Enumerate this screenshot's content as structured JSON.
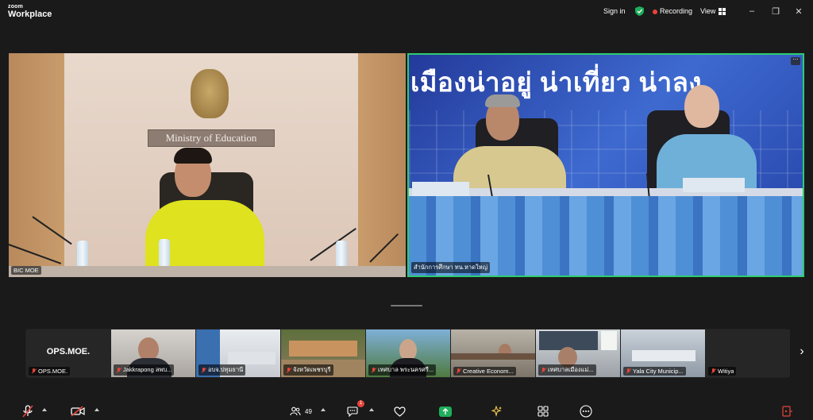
{
  "titlebar": {
    "brand_small": "zoom",
    "brand_big": "Workplace",
    "sign_in": "Sign in",
    "recording": "Recording",
    "view": "View"
  },
  "main_tiles": [
    {
      "name": "BIC MOE",
      "sign": "Ministry of Education"
    },
    {
      "name": "สำนักการศึกษา ทน.หาดใหญ่",
      "banner": "เมืองน่าอยู่ น่าเที่ยว น่าลง"
    }
  ],
  "strip": {
    "thumbnails": [
      {
        "name": "OPS.MOE.",
        "display_text": "OPS.MOE.",
        "muted": true
      },
      {
        "name": "Jakkrapong ลพบ...",
        "muted": true
      },
      {
        "name": "อบจ.ปทุมธานี",
        "muted": true
      },
      {
        "name": "จังหวัดเพชรบุรี",
        "muted": true
      },
      {
        "name": "เทศบาล พระนครศรี...",
        "muted": true
      },
      {
        "name": "Creative Econom...",
        "muted": true
      },
      {
        "name": "เทศบาลเมืองแม่...",
        "muted": true
      },
      {
        "name": "Yala City Municip...",
        "muted": true
      },
      {
        "name": "Witiya",
        "muted": true
      }
    ]
  },
  "toolbar": {
    "participants_count": "49",
    "chat_badge": "1"
  },
  "colors": {
    "active_speaker": "#2ecc71",
    "recording_dot": "#e8443a",
    "share_green": "#1fae5b"
  }
}
